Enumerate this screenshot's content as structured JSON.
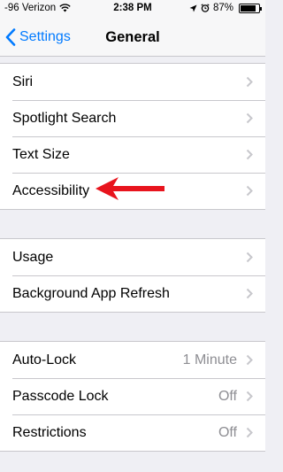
{
  "status_bar": {
    "carrier": "-96 Verizon",
    "time": "2:38 PM",
    "battery_percent": "87%",
    "battery_level": 0.87
  },
  "nav": {
    "back_label": "Settings",
    "title": "General"
  },
  "groups": [
    {
      "rows": [
        {
          "label": "Siri"
        },
        {
          "label": "Spotlight Search"
        },
        {
          "label": "Text Size"
        },
        {
          "label": "Accessibility"
        }
      ]
    },
    {
      "rows": [
        {
          "label": "Usage"
        },
        {
          "label": "Background App Refresh"
        }
      ]
    },
    {
      "rows": [
        {
          "label": "Auto-Lock",
          "value": "1 Minute"
        },
        {
          "label": "Passcode Lock",
          "value": "Off"
        },
        {
          "label": "Restrictions",
          "value": "Off"
        }
      ]
    }
  ],
  "colors": {
    "accent": "#007aff",
    "annotation": "#e8141d",
    "background": "#efeff4"
  },
  "icons": {
    "wifi": "wifi-icon",
    "location": "location-arrow-icon",
    "alarm": "alarm-clock-icon",
    "back": "chevron-left-icon",
    "disclosure": "chevron-right-icon"
  }
}
